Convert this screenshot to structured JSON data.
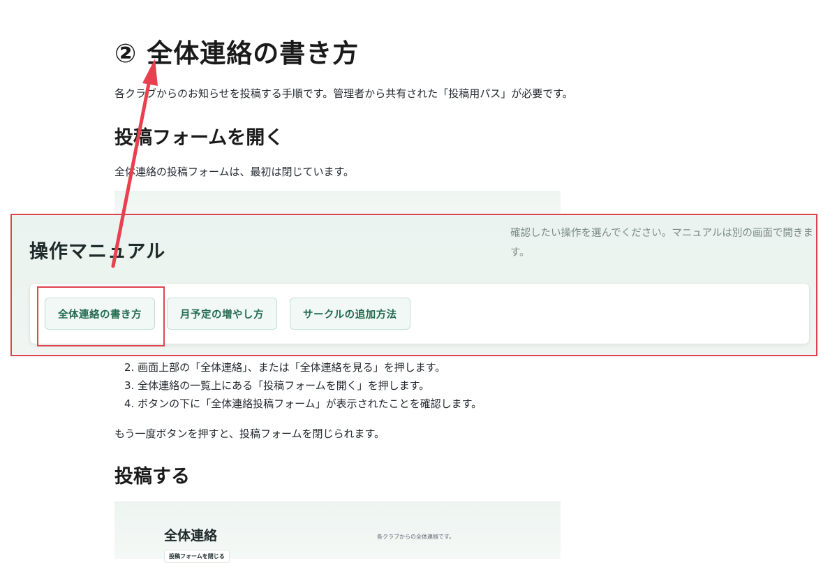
{
  "doc": {
    "title": "② 全体連絡の書き方",
    "intro": "各クラブからのお知らせを投稿する手順です。管理者から共有された「投稿用パス」が必要です。",
    "section_open": {
      "heading": "投稿フォームを開く",
      "text": "全体連絡の投稿フォームは、最初は閉じています。"
    },
    "steps": [
      "2. 画面上部の「全体連絡」、または「全体連絡を見る」を押します。",
      "3. 全体連絡の一覧上にある「投稿フォームを開く」を押します。",
      "4. ボタンの下に「全体連絡投稿フォーム」が表示されたことを確認します。"
    ],
    "close_note": "もう一度ボタンを押すと、投稿フォームを閉じられます。",
    "section_post": {
      "heading": "投稿する"
    },
    "screenshot2": {
      "title": "全体連絡",
      "desc": "各クラブからの全体連絡です。",
      "button": "投稿フォームを閉じる"
    }
  },
  "panel": {
    "title": "操作マニュアル",
    "description": "確認したい操作を選んでください。マニュアルは別の画面で開きます。",
    "buttons": [
      {
        "label": "全体連絡の書き方"
      },
      {
        "label": "月予定の増やし方"
      },
      {
        "label": "サークルの追加方法"
      }
    ]
  },
  "colors": {
    "accent": "#e0424f",
    "button_text": "#236b52",
    "panel_bg": "#eaf3ef"
  }
}
